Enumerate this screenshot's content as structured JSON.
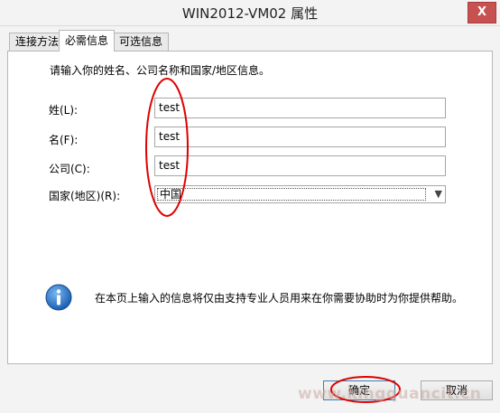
{
  "window": {
    "title": "WIN2012-VM02 属性",
    "close_label": "X"
  },
  "tabs": [
    {
      "label": "连接方法"
    },
    {
      "label": "必需信息"
    },
    {
      "label": "可选信息"
    }
  ],
  "form": {
    "intro": "请输入你的姓名、公司名称和国家/地区信息。",
    "last_name": {
      "label": "姓(L):",
      "value": "test"
    },
    "first_name": {
      "label": "名(F):",
      "value": "test"
    },
    "company": {
      "label": "公司(C):",
      "value": "test"
    },
    "country": {
      "label": "国家(地区)(R):",
      "value": "中国"
    }
  },
  "info": {
    "icon": "info-icon",
    "text": "在本页上输入的信息将仅由支持专业人员用来在你需要协助时为你提供帮助。"
  },
  "buttons": {
    "ok": "确定",
    "cancel": "取消"
  },
  "watermark": "www.kingquancit.cn",
  "colors": {
    "annotation": "#e00000",
    "info": "#1a6fc7",
    "close": "#c75050"
  }
}
